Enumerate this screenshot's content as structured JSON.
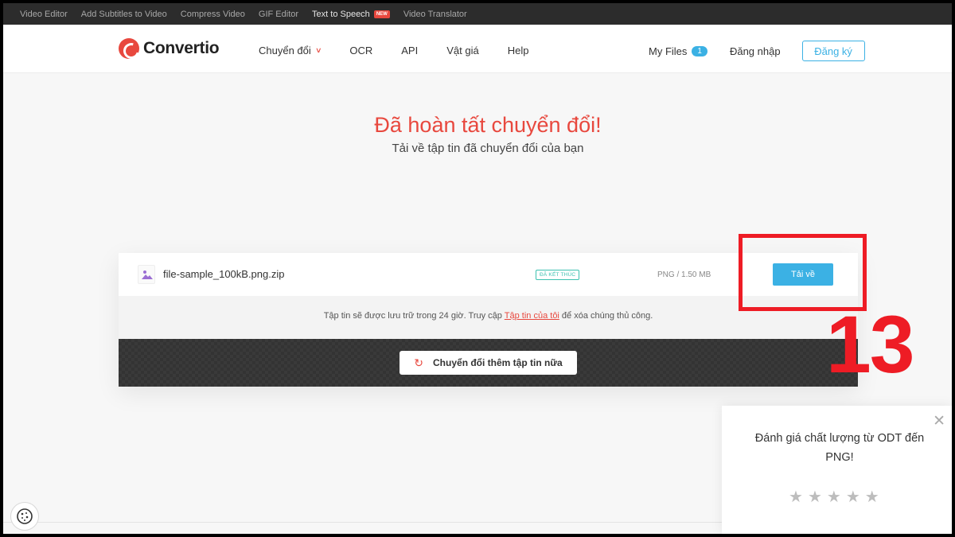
{
  "toolbar": {
    "items": [
      "Video Editor",
      "Add Subtitles to Video",
      "Compress Video",
      "GIF Editor",
      "Text to Speech",
      "Video Translator"
    ],
    "new_badge": "NEW"
  },
  "header": {
    "logo": "Convertio",
    "nav": {
      "convert": "Chuyển đổi",
      "ocr": "OCR",
      "api": "API",
      "pricing": "Vật giá",
      "help": "Help"
    },
    "my_files": "My Files",
    "my_files_count": "1",
    "login": "Đăng nhập",
    "signup": "Đăng ký"
  },
  "main": {
    "title": "Đã hoàn tất chuyển đổi!",
    "subtitle": "Tải về tập tin đã chuyển đổi của bạn"
  },
  "file": {
    "name": "file-sample_100kB.png.zip",
    "status": "ĐÃ KẾT THÚC",
    "size": "PNG / 1.50 MB",
    "download": "Tải về"
  },
  "note": {
    "before": "Tập tin sẽ được lưu trữ trong 24 giờ. Truy cập ",
    "link": "Tập tin của tôi",
    "after": " để xóa chúng thủ công."
  },
  "convert_more": "Chuyển đổi thêm tập tin nữa",
  "annotation": {
    "number": "13",
    "color": "#ee1c25"
  },
  "rating": {
    "text": "Đánh giá chất lượng từ ODT đến PNG!",
    "stars": 5
  },
  "colors": {
    "brand": "#e8483e",
    "accent": "#3bb1e4"
  }
}
